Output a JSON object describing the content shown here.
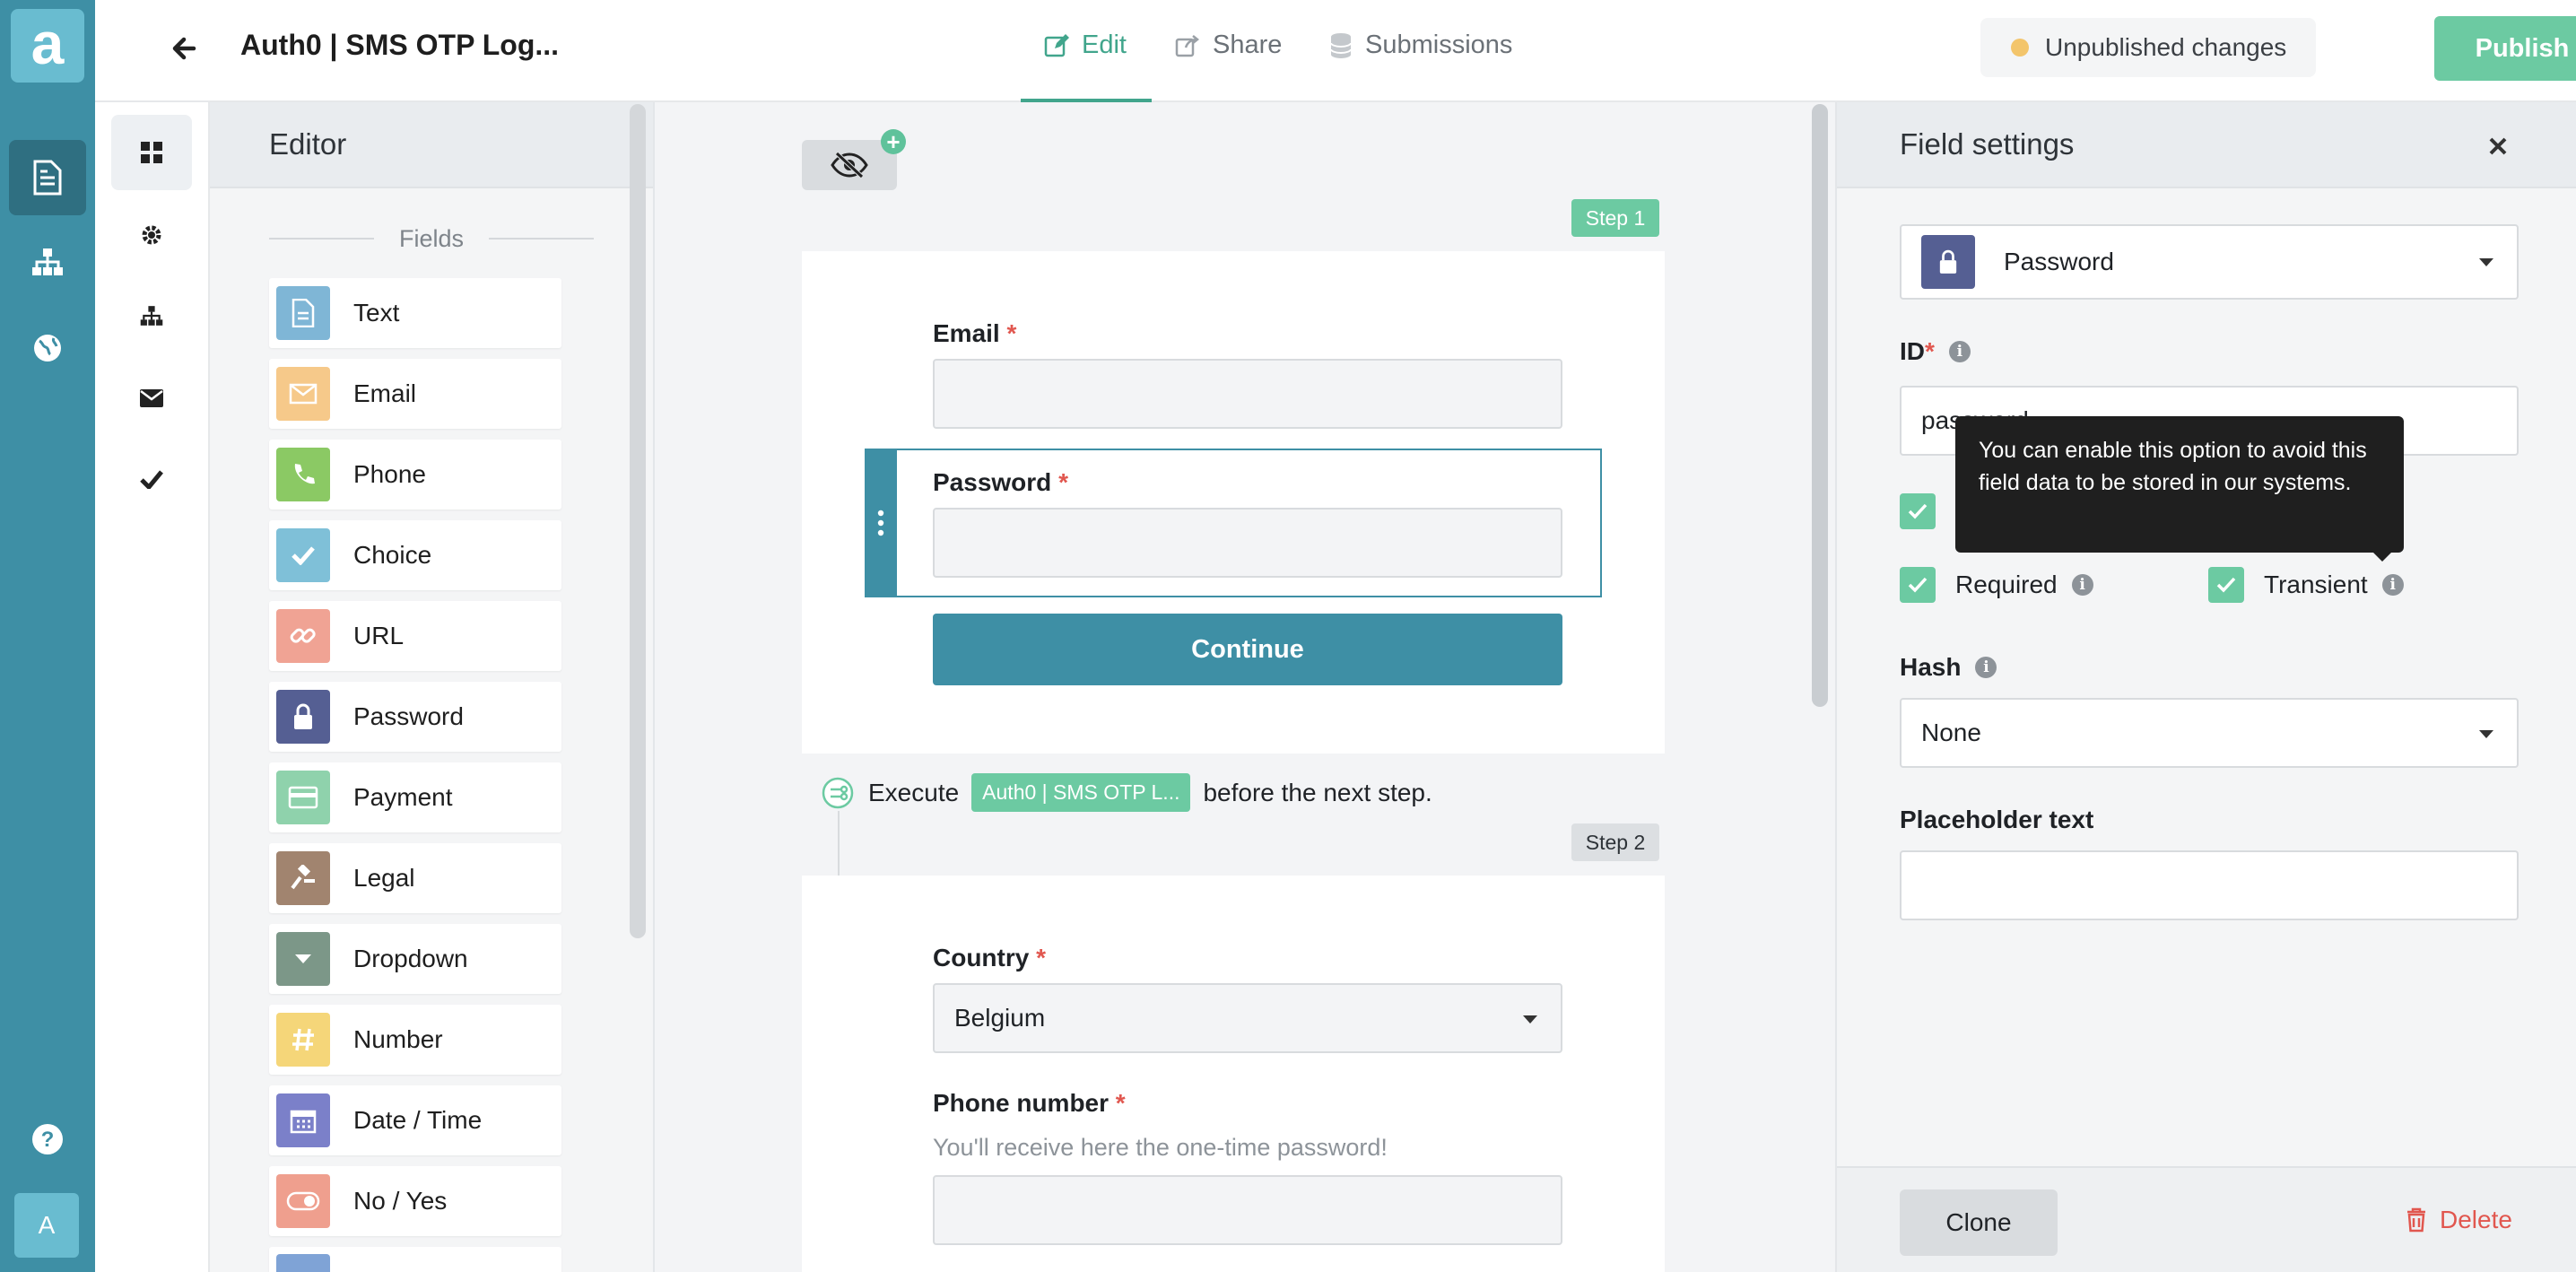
{
  "app": {
    "logo_letter": "a",
    "user_initial": "A",
    "accent_color": "#3e8fa5",
    "success_color": "#6ccaa2"
  },
  "header": {
    "title": "Auth0 | SMS OTP Log...",
    "tabs": [
      {
        "label": "Edit",
        "icon": "pencil-icon",
        "active": true
      },
      {
        "label": "Share",
        "icon": "share-icon",
        "active": false
      },
      {
        "label": "Submissions",
        "icon": "database-icon",
        "active": false
      }
    ],
    "status": "Unpublished changes",
    "publish_label": "Publish"
  },
  "editor": {
    "title": "Editor",
    "section_label": "Fields",
    "fields": [
      {
        "label": "Text",
        "icon": "document-icon",
        "color": "#7fb6d6"
      },
      {
        "label": "Email",
        "icon": "envelope-icon",
        "color": "#f6c98a"
      },
      {
        "label": "Phone",
        "icon": "phone-icon",
        "color": "#8bc964"
      },
      {
        "label": "Choice",
        "icon": "check-icon",
        "color": "#7fc0d8"
      },
      {
        "label": "URL",
        "icon": "link-icon",
        "color": "#f0a394"
      },
      {
        "label": "Password",
        "icon": "lock-icon",
        "color": "#555f93"
      },
      {
        "label": "Payment",
        "icon": "credit-card-icon",
        "color": "#8fd2ac"
      },
      {
        "label": "Legal",
        "icon": "gavel-icon",
        "color": "#a1846f"
      },
      {
        "label": "Dropdown",
        "icon": "dropdown-icon",
        "color": "#7c9788"
      },
      {
        "label": "Number",
        "icon": "hash-icon",
        "color": "#f5d679"
      },
      {
        "label": "Date / Time",
        "icon": "calendar-icon",
        "color": "#7b80c9"
      },
      {
        "label": "No / Yes",
        "icon": "toggle-icon",
        "color": "#ef9f8e"
      }
    ]
  },
  "canvas": {
    "step1_label": "Step 1",
    "step2_label": "Step 2",
    "email_label": "Email",
    "password_label": "Password",
    "required_mark": "*",
    "continue_label": "Continue",
    "execute_prefix": "Execute",
    "execute_chip": "Auth0 | SMS OTP L...",
    "execute_suffix": "before the next step.",
    "country_label": "Country",
    "country_value": "Belgium",
    "phone_label": "Phone number",
    "phone_hint": "You'll receive here the one-time password!"
  },
  "settings": {
    "title": "Field settings",
    "field_type": "Password",
    "id_label": "ID",
    "id_value": "password",
    "required_label": "Required",
    "transient_label": "Transient",
    "tooltip": "You can enable this option to avoid this field data to be stored in our systems.",
    "hash_label": "Hash",
    "hash_value": "None",
    "placeholder_label": "Placeholder text",
    "placeholder_value": "",
    "clone_label": "Clone",
    "delete_label": "Delete"
  }
}
